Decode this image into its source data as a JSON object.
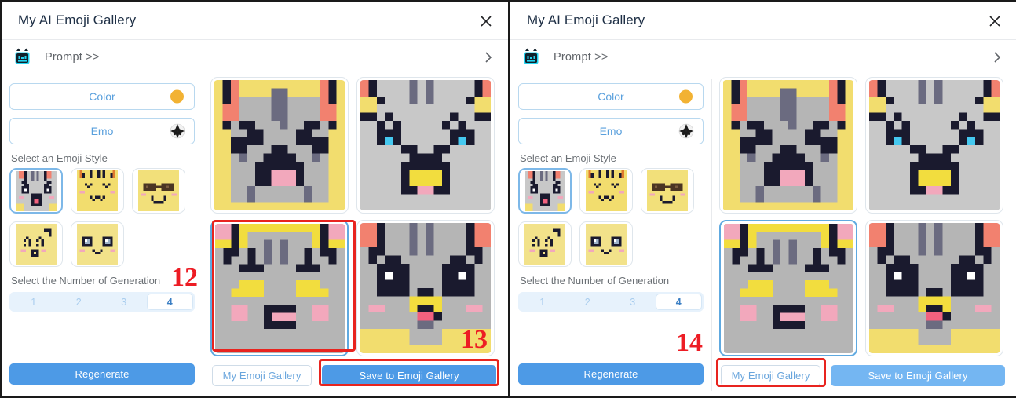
{
  "window": {
    "title": "My AI Emoji Gallery",
    "close_icon": "close-x-icon"
  },
  "prompt": {
    "icon": "robot-cat-icon",
    "label": "Prompt >>",
    "chevron_icon": "chevron-right-icon"
  },
  "controls": {
    "color": {
      "label": "Color",
      "swatch_icon": "color-circle-icon",
      "swatch_color": "#f2b233"
    },
    "emo": {
      "label": "Emo",
      "icon": "emo-face-icon"
    }
  },
  "style_section": {
    "label": "Select an Emoji Style",
    "items": [
      {
        "name": "style-grey-cat",
        "selected": true,
        "bg": "#c8c8c8"
      },
      {
        "name": "style-yellow-tiger",
        "selected": false,
        "bg": "#f2dd6e"
      },
      {
        "name": "style-sunglasses",
        "selected": false,
        "bg": "#f2e07a"
      },
      {
        "name": "style-blush-smile",
        "selected": false,
        "bg": "#f2e28a"
      },
      {
        "name": "style-big-eyes",
        "selected": false,
        "bg": "#f2e28a"
      }
    ]
  },
  "generation_section": {
    "label": "Select the Number of Generation",
    "options": [
      "1",
      "2",
      "3",
      "4"
    ],
    "selected": "4"
  },
  "buttons": {
    "regenerate": "Regenerate",
    "my_gallery": "My Emoji Gallery",
    "save_gallery": "Save to Emoji Gallery"
  },
  "gallery": {
    "cards": [
      {
        "name": "emoji-result-1",
        "selected": false
      },
      {
        "name": "emoji-result-2",
        "selected": false
      },
      {
        "name": "emoji-result-3",
        "selected": true
      },
      {
        "name": "emoji-result-4",
        "selected": false
      }
    ]
  },
  "annotations": {
    "left_panel": [
      {
        "number": "12"
      },
      {
        "number": "13"
      }
    ],
    "right_panel": [
      {
        "number": "14"
      }
    ],
    "color": "#ed1c24"
  }
}
